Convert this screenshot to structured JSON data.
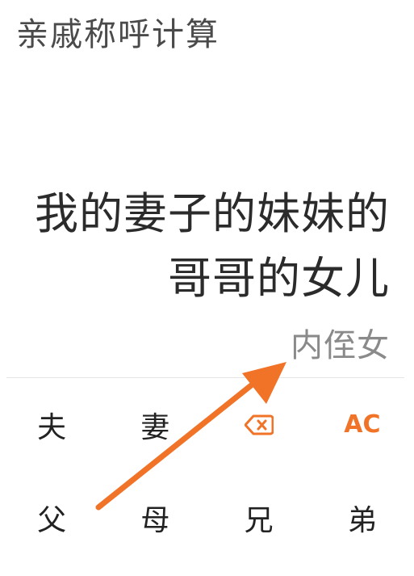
{
  "app": {
    "title": "亲戚称呼计算"
  },
  "display": {
    "expression": "我的妻子的妹妹的哥哥的女儿",
    "result": "内侄女"
  },
  "keypad": {
    "husband": "夫",
    "wife": "妻",
    "backspace_icon": "backspace-icon",
    "clear": "AC",
    "father": "父",
    "mother": "母",
    "elder_brother": "兄",
    "younger_brother": "弟"
  },
  "colors": {
    "accent": "#f07327",
    "title": "#4a4a4a",
    "expression": "#2b2b2b",
    "result": "#8a8a8a"
  },
  "annotation": {
    "arrow": "orange-arrow pointing to result"
  }
}
